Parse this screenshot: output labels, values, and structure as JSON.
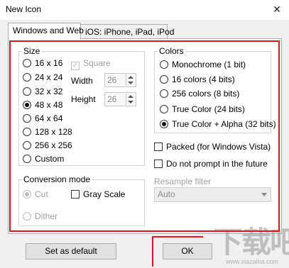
{
  "window": {
    "title": "New Icon",
    "close_glyph": "✕"
  },
  "tabs": [
    {
      "label": "Windows and Web",
      "active": true
    },
    {
      "label": "iOS: iPhone, iPad, iPod",
      "active": false
    }
  ],
  "size_group": {
    "label": "Size",
    "options": [
      {
        "label": "16 x 16",
        "checked": false
      },
      {
        "label": "24 x 24",
        "checked": false
      },
      {
        "label": "32 x 32",
        "checked": false
      },
      {
        "label": "48 x 48",
        "checked": true
      },
      {
        "label": "64 x 64",
        "checked": false
      },
      {
        "label": "128 x 128",
        "checked": false
      },
      {
        "label": "256 x 256",
        "checked": false
      },
      {
        "label": "Custom",
        "checked": false
      }
    ],
    "square_label": "Square",
    "width_label": "Width",
    "width_value": "26",
    "height_label": "Height",
    "height_value": "26"
  },
  "colors_group": {
    "label": "Colors",
    "options": [
      {
        "label": "Monochrome (1 bit)",
        "checked": false
      },
      {
        "label": "16 colors (4 bits)",
        "checked": false
      },
      {
        "label": "256 colors (8 bits)",
        "checked": false
      },
      {
        "label": "True Color (24 bits)",
        "checked": false
      },
      {
        "label": "True Color + Alpha (32 bits)",
        "checked": true
      }
    ]
  },
  "options": {
    "packed_label": "Packed (for Windows Vista)",
    "no_prompt_label": "Do not prompt in the future"
  },
  "conversion_group": {
    "label": "Conversion mode",
    "cut_label": "Cut",
    "dither_label": "Dither",
    "grayscale_label": "Gray Scale"
  },
  "resample": {
    "label": "Resample filter",
    "value": "Auto"
  },
  "buttons": {
    "set_default": "Set as default",
    "ok": "OK"
  },
  "watermark": {
    "text": "下载吧",
    "sub": "www.xiazaiba.com"
  },
  "accent_color": "#e8141c"
}
